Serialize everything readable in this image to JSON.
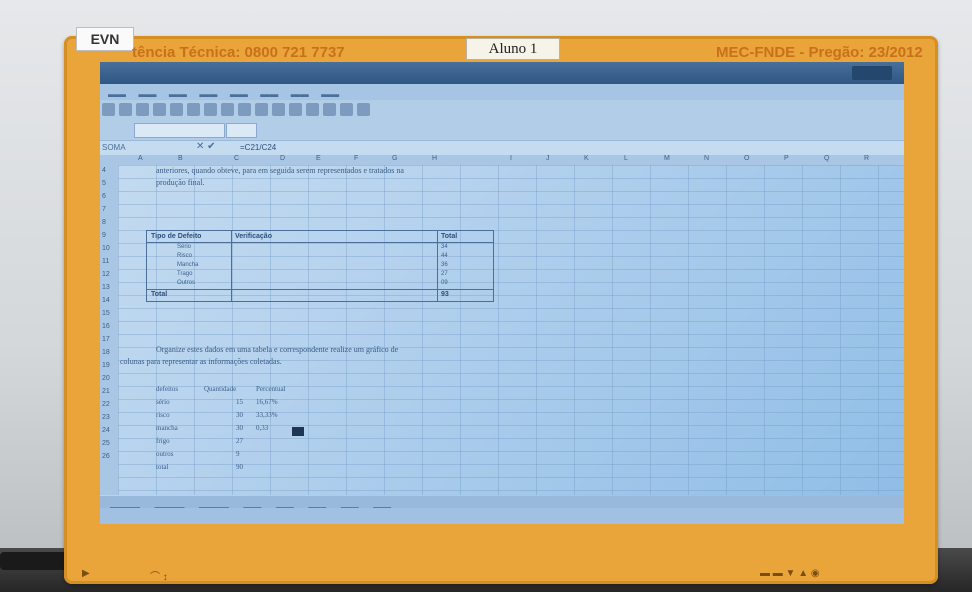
{
  "frame": {
    "evn": "EVN",
    "left_label": "tência Técnica: 0800 721 7737",
    "student_tag": "Aluno 1",
    "right_label": "MEC-FNDE - Pregão: 23/2012"
  },
  "app": {
    "name_box": "SOMA",
    "formula": "=C21/C24"
  },
  "sheet": {
    "para_top": [
      "anteriores, quando obteve, para em seguida serem representados e tratados na",
      "produção final."
    ],
    "table_headers": [
      "Tipo de Defeito",
      "Verificação",
      "Total"
    ],
    "table_rows": [
      {
        "tipo": "Sério",
        "total": "34"
      },
      {
        "tipo": "Risco",
        "total": "44"
      },
      {
        "tipo": "Mancha",
        "total": "36"
      },
      {
        "tipo": "Trago",
        "total": "27"
      },
      {
        "tipo": "Outros",
        "total": "09"
      }
    ],
    "table_total_label": "Total",
    "table_total_value": "93",
    "para_bottom": [
      "Organize estes dados em uma tabela e correspondente realize um gráfico de",
      "colunas para representar as informações coletadas."
    ],
    "small_headers": [
      "defeitos",
      "Quantidade",
      "Percentual"
    ],
    "small_rows": [
      {
        "name": "sério",
        "qty": "15",
        "pct": "16,67%"
      },
      {
        "name": "risco",
        "qty": "30",
        "pct": "33,33%"
      },
      {
        "name": "mancha",
        "qty": "30",
        "pct": "0,33"
      },
      {
        "name": "frigo",
        "qty": "27",
        "pct": ""
      },
      {
        "name": "outros",
        "qty": "9",
        "pct": ""
      },
      {
        "name": "total",
        "qty": "90",
        "pct": ""
      }
    ]
  }
}
